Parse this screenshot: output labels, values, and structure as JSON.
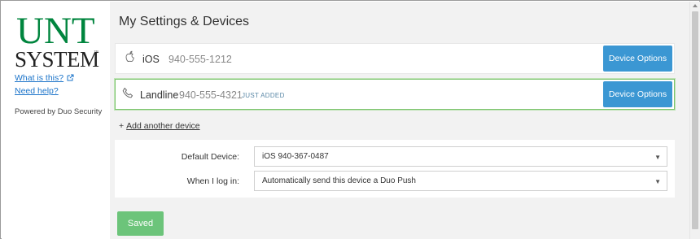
{
  "sidebar": {
    "logo_line1": "UNT",
    "logo_line2": "SYSTEM",
    "logo_tm": "™",
    "what_is_this": "What is this?",
    "need_help": "Need help?",
    "powered_by": "Powered by Duo Security"
  },
  "main": {
    "title": "My Settings & Devices",
    "devices": [
      {
        "icon": "apple-icon",
        "name": "iOS",
        "number": "940-555-1212",
        "badge": "",
        "button": "Device Options"
      },
      {
        "icon": "phone-icon",
        "name": "Landline",
        "number": "940-555-4321",
        "badge": "JUST ADDED",
        "button": "Device Options"
      }
    ],
    "add_device_plus": "+",
    "add_device": "Add another device",
    "settings": {
      "default_device_label": "Default Device:",
      "default_device_value": "iOS 940-367-0487",
      "login_label": "When I log in:",
      "login_value": "Automatically send this device a Duo Push"
    },
    "saved_button": "Saved"
  },
  "colors": {
    "brand_green": "#00853e",
    "button_blue": "#3b97d3",
    "saved_green": "#6cc47a",
    "added_border": "#7dc46e"
  }
}
